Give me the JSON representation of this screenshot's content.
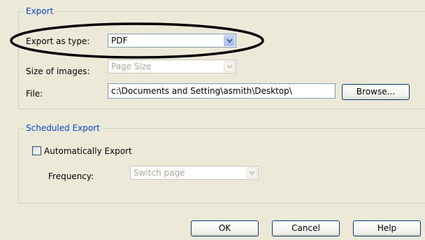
{
  "export_group": {
    "title": "Export",
    "export_type": {
      "label": "Export as type:",
      "value": "PDF"
    },
    "image_size": {
      "label": "Size of images:",
      "value": "Page Size"
    },
    "file": {
      "label": "File:",
      "value": "c:\\Documents and Setting\\asmith\\Desktop\\",
      "browse_label": "Browse..."
    }
  },
  "scheduled_group": {
    "title": "Scheduled Export",
    "auto_export": {
      "label": "Automatically Export",
      "checked": false
    },
    "frequency": {
      "label": "Frequency:",
      "value": "Switch page"
    }
  },
  "footer": {
    "ok_label": "OK",
    "cancel_label": "Cancel",
    "help_label": "Help"
  },
  "colors": {
    "dialog_background": "#ece9d8",
    "group_title": "#0046d5",
    "disabled_text": "#aca899",
    "annotation_ellipse": "#000000"
  },
  "icons": {
    "combo_arrow": "chevron-down-icon"
  }
}
